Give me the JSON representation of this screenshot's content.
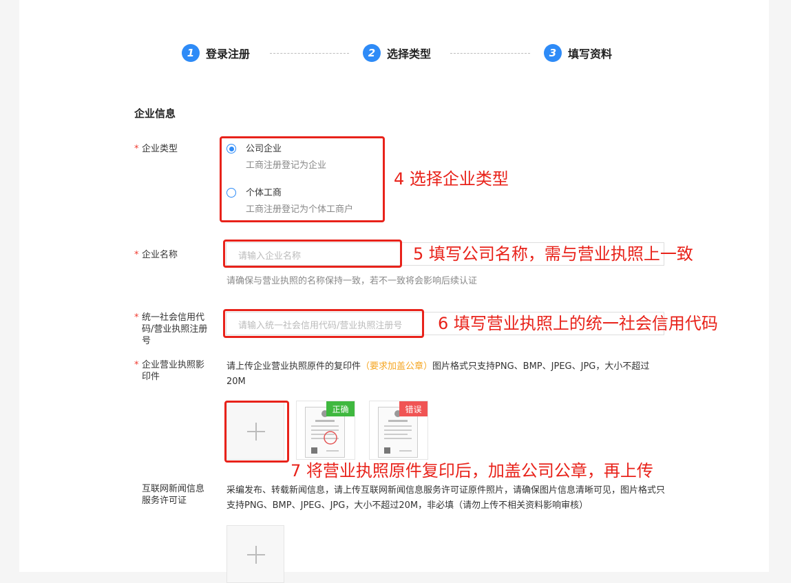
{
  "steps": [
    {
      "num": "1",
      "label": "登录注册"
    },
    {
      "num": "2",
      "label": "选择类型"
    },
    {
      "num": "3",
      "label": "填写资料"
    }
  ],
  "section_title": "企业信息",
  "required_mark": "*",
  "company_type": {
    "label": "企业类型",
    "options": [
      {
        "title": "公司企业",
        "desc": "工商注册登记为企业",
        "selected": true
      },
      {
        "title": "个体工商",
        "desc": "工商注册登记为个体工商户",
        "selected": false
      }
    ]
  },
  "company_name": {
    "label": "企业名称",
    "placeholder": "请输入企业名称",
    "hint": "请确保与营业执照的名称保持一致，若不一致将会影响后续认证"
  },
  "credit_code": {
    "label": "统一社会信用代码/营业执照注册号",
    "placeholder": "请输入统一社会信用代码/营业执照注册号"
  },
  "license": {
    "label": "企业营业执照影印件",
    "desc_before": "请上传企业营业执照原件的复印件",
    "desc_warn": "（要求加盖公章）",
    "desc_after": "图片格式只支持PNG、BMP、JPEG、JPG，大小不超过20M",
    "sample_correct": "正确",
    "sample_wrong": "错误"
  },
  "news_permit": {
    "label": "互联网新闻信息服务许可证",
    "desc": "采编发布、转载新闻信息，请上传互联网新闻信息服务许可证原件照片，请确保图片信息清晰可见，图片格式只支持PNG、BMP、JPEG、JPG，大小不超过20M，非必填（请勿上传不相关资料影响审核）"
  },
  "annotations": {
    "a4": "4 选择企业类型",
    "a5": "5 填写公司名称，需与营业执照上一致",
    "a6": "6 填写营业执照上的统一社会信用代码",
    "a7": "7 将营业执照原件复印后，加盖公司公章，再上传"
  },
  "colors": {
    "accent": "#2e8bf7",
    "annotation": "#e8221a",
    "warn": "#f5a623",
    "correct": "#3fb83f",
    "wrong": "#f05454"
  }
}
